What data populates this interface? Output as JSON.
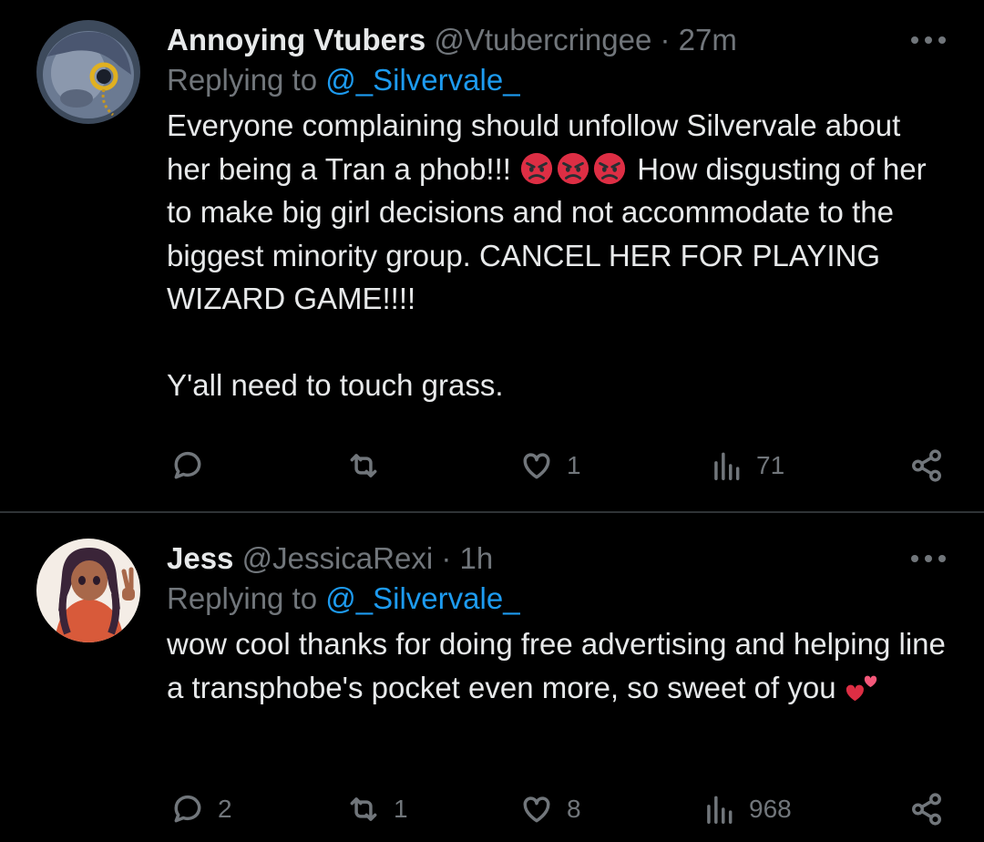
{
  "tweets": [
    {
      "display_name": "Annoying Vtubers",
      "handle": "@Vtubercringee",
      "time": "27m",
      "replying_label": "Replying to",
      "replying_to": "@_Silvervale_",
      "body_part1": "Everyone complaining should unfollow Silvervale about her being a Tran a phob!!! ",
      "emoji_1": "angry-face-emoji",
      "body_part2": " How disgusting of her to make big girl decisions and not accommodate to the biggest minority group. CANCEL HER FOR PLAYING WIZARD GAME!!!!\n\nY'all need to touch grass.",
      "replies": "",
      "retweets": "",
      "likes": "1",
      "views": "71"
    },
    {
      "display_name": "Jess",
      "handle": "@JessicaRexi",
      "time": "1h",
      "replying_label": "Replying to",
      "replying_to": "@_Silvervale_",
      "body": "wow cool thanks for doing free advertising and helping line a transphobe's pocket even more, so sweet of you ",
      "emoji": "two-hearts-emoji",
      "replies": "2",
      "retweets": "1",
      "likes": "8",
      "views": "968"
    }
  ],
  "icons": {
    "reply": "reply-icon",
    "retweet": "retweet-icon",
    "like": "heart-icon",
    "views": "views-icon",
    "share": "share-icon",
    "more": "more-icon"
  },
  "colors": {
    "background": "#000000",
    "text": "#e7e9ea",
    "muted": "#71767b",
    "mention": "#1d9bf0",
    "divider": "#2f3336"
  }
}
